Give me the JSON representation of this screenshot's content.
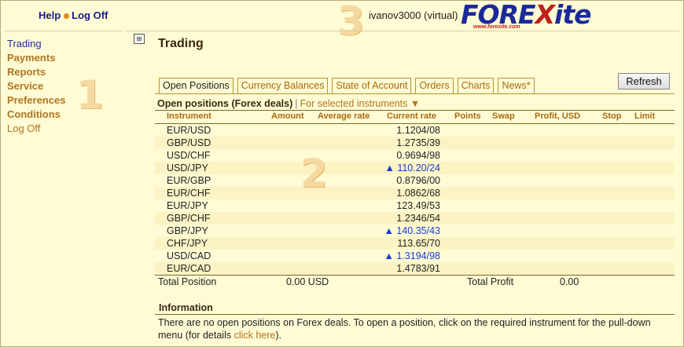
{
  "header": {
    "help": "Help",
    "logoff": "Log Off",
    "username": "ivanov3000 (virtual)",
    "logo": {
      "pre": "FORE",
      "x": "X",
      "post": "ite",
      "url": "www.forexite.com"
    },
    "callouts": {
      "one": "1",
      "two": "2",
      "three": "3"
    }
  },
  "sidebar": {
    "items": [
      {
        "label": "Trading"
      },
      {
        "label": "Payments"
      },
      {
        "label": "Reports"
      },
      {
        "label": "Service"
      },
      {
        "label": "Preferences"
      },
      {
        "label": "Conditions"
      },
      {
        "label": "Log Off"
      }
    ]
  },
  "main": {
    "title": "Trading",
    "tabs": [
      {
        "label": "Open Positions"
      },
      {
        "label": "Currency Balances"
      },
      {
        "label": "State of Account"
      },
      {
        "label": "Orders"
      },
      {
        "label": "Charts"
      },
      {
        "label": "News*"
      }
    ],
    "refresh": "Refresh",
    "section_title": "Open positions (Forex deals)",
    "section_sep": "|",
    "filter": "For selected instruments ▼",
    "columns": {
      "instrument": "Instrument",
      "amount": "Amount",
      "avg_rate": "Average rate",
      "current_rate": "Current rate",
      "points": "Points",
      "swap": "Swap",
      "profit": "Profit, USD",
      "stop": "Stop",
      "limit": "Limit"
    },
    "rows": [
      {
        "instrument": "EUR/USD",
        "rate": "1.1204/08"
      },
      {
        "instrument": "GBP/USD",
        "rate": "1.2735/39"
      },
      {
        "instrument": "USD/CHF",
        "rate": "0.9694/98"
      },
      {
        "instrument": "USD/JPY",
        "rate": "▲ 110.20/24"
      },
      {
        "instrument": "EUR/GBP",
        "rate": "0.8796/00"
      },
      {
        "instrument": "EUR/CHF",
        "rate": "1.0862/68"
      },
      {
        "instrument": "EUR/JPY",
        "rate": "123.49/53"
      },
      {
        "instrument": "GBP/CHF",
        "rate": "1.2346/54"
      },
      {
        "instrument": "GBP/JPY",
        "rate": "▲ 140.35/43"
      },
      {
        "instrument": "CHF/JPY",
        "rate": "113.65/70"
      },
      {
        "instrument": "USD/CAD",
        "rate": "▲ 1.3194/98"
      },
      {
        "instrument": "EUR/CAD",
        "rate": "1.4783/91"
      }
    ],
    "totals": {
      "position_label": "Total Position",
      "position_value": "0.00 USD",
      "profit_label": "Total Profit",
      "profit_value": "0.00"
    },
    "info": {
      "title": "Information",
      "text": "There are no open positions on Forex deals. To open a position, click on the required instrument for the pull-down menu (for details ",
      "link": "click here",
      "end": ")."
    }
  },
  "colors": {
    "background": "#fffbd4",
    "accent": "#b07520",
    "link": "#1a1a8c",
    "rate_up": "#1a3ad0"
  }
}
